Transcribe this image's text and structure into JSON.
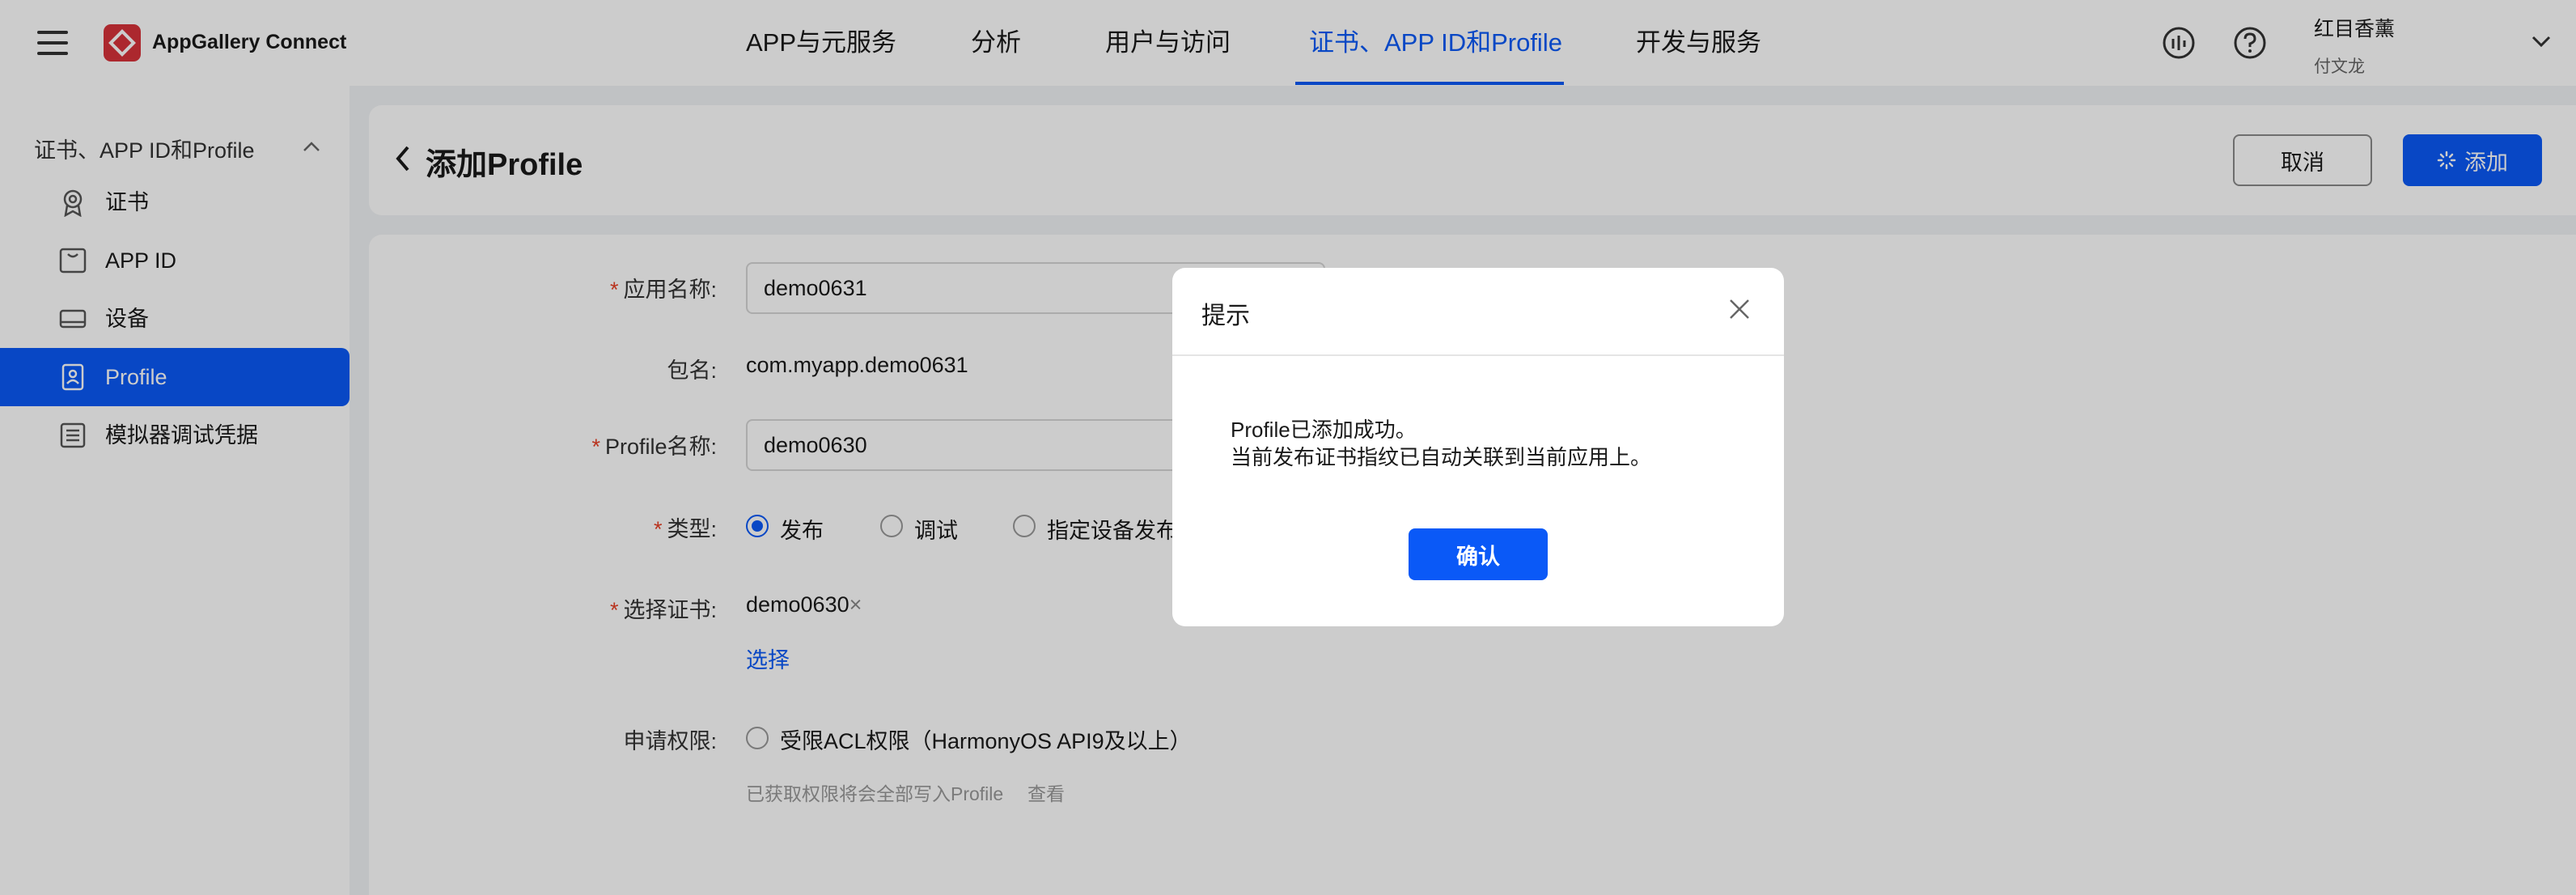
{
  "header": {
    "brand": "AppGallery Connect",
    "nav": [
      "APP与元服务",
      "分析",
      "用户与访问",
      "证书、APP ID和Profile",
      "开发与服务"
    ],
    "active_nav_index": 3,
    "user_name": "红目香薰",
    "user_sub": "付文龙"
  },
  "sidebar": {
    "group_label": "证书、APP ID和Profile",
    "items": [
      {
        "label": "证书",
        "icon": "certificate-icon"
      },
      {
        "label": "APP ID",
        "icon": "app-id-icon"
      },
      {
        "label": "设备",
        "icon": "device-icon"
      },
      {
        "label": "Profile",
        "icon": "profile-icon"
      },
      {
        "label": "模拟器调试凭据",
        "icon": "list-icon"
      }
    ],
    "active_index": 3
  },
  "page": {
    "title": "添加Profile",
    "cancel_label": "取消",
    "add_label": "添加"
  },
  "form": {
    "app_name_label": "应用名称:",
    "app_name_value": "demo0631",
    "package_label": "包名:",
    "package_value": "com.myapp.demo0631",
    "profile_name_label": "Profile名称:",
    "profile_name_value": "demo0630",
    "type_label": "类型:",
    "type_options": [
      "发布",
      "调试",
      "指定设备发布"
    ],
    "type_selected_index": 0,
    "cert_label": "选择证书:",
    "cert_value": "demo0630",
    "cert_remove": "×",
    "select_link": "选择",
    "permission_label": "申请权限:",
    "permission_option": "受限ACL权限（HarmonyOS API9及以上）",
    "permission_hint": "已获取权限将会全部写入Profile",
    "view_link": "查看"
  },
  "dialog": {
    "title": "提示",
    "message_line1": "Profile已添加成功。",
    "message_line2": "当前发布证书指纹已自动关联到当前应用上。",
    "ok_label": "确认"
  },
  "colors": {
    "accent": "#0a59f7",
    "required": "#e84026",
    "overlay": "rgba(0,0,0,0.2)"
  }
}
